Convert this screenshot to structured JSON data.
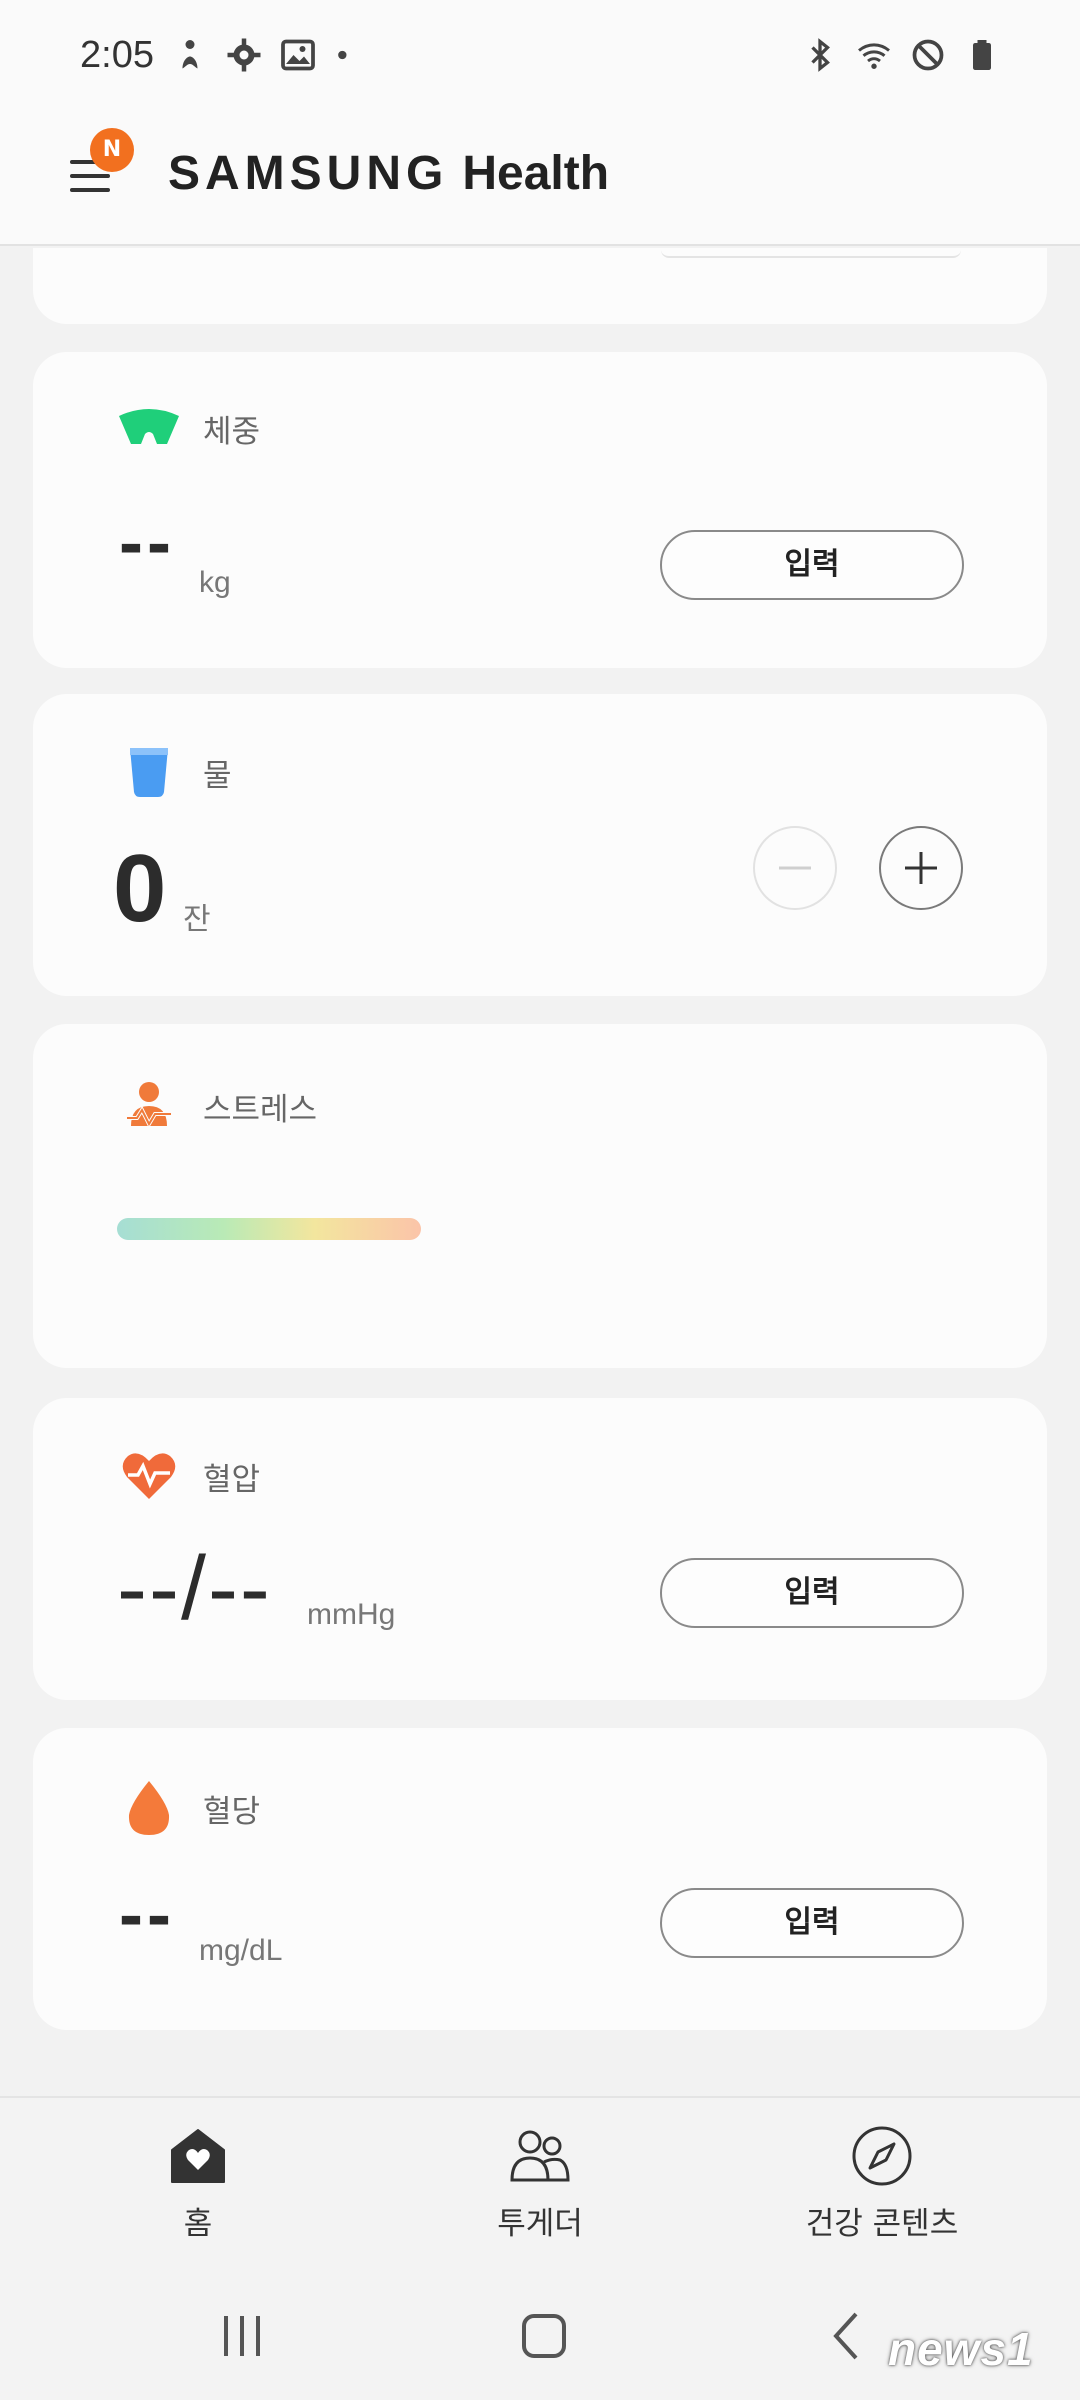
{
  "status_bar": {
    "time": "2:05"
  },
  "header": {
    "menu_badge": "N",
    "brand_part1": "SAMSUNG",
    "brand_part2": "Health"
  },
  "cards": {
    "weight": {
      "title": "체중",
      "value": "--",
      "unit": "kg",
      "button": "입력",
      "icon": "weight-scale-icon",
      "color": "#1fcf7a"
    },
    "water": {
      "title": "물",
      "value": "0",
      "unit": "잔",
      "icon": "water-cup-icon",
      "color": "#4a9cf2"
    },
    "stress": {
      "title": "스트레스",
      "icon": "stress-person-icon",
      "color": "#f07a3a"
    },
    "blood_pressure": {
      "title": "혈압",
      "value": "--/--",
      "unit": "mmHg",
      "button": "입력",
      "icon": "heart-pulse-icon",
      "color": "#f06a3a"
    },
    "blood_glucose": {
      "title": "혈당",
      "value": "--",
      "unit": "mg/dL",
      "button": "입력",
      "icon": "blood-drop-icon",
      "color": "#f47a3a"
    }
  },
  "bottom_nav": {
    "home": "홈",
    "together": "투게더",
    "health_content": "건강 콘텐츠"
  },
  "watermark": "news1"
}
